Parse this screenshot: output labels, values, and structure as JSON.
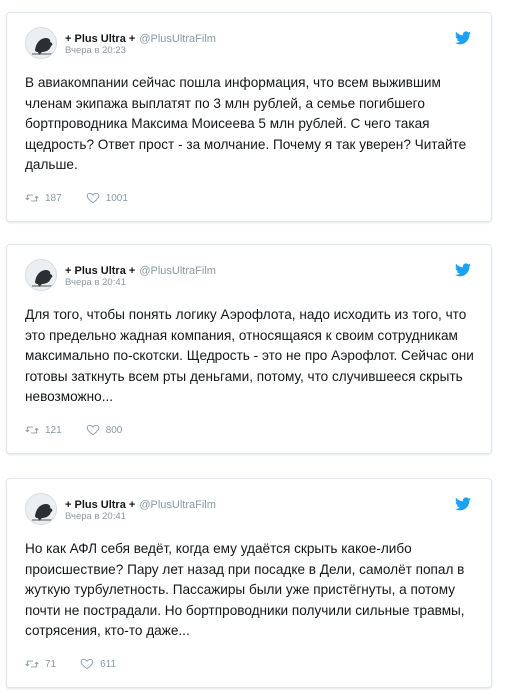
{
  "brand": {
    "twitter_blue": "#1da1f2",
    "muted": "#8899a6"
  },
  "tweets": [
    {
      "display_name": "+ Plus Ultra +",
      "handle": "@PlusUltraFilm",
      "time": "Вчера в 20:23",
      "text": "В авиакомпании сейчас пошла информация, что всем выжившим членам экипажа выплатят по 3 млн рублей, а семье погибшего бортпроводника Максима Моисеева 5 млн рублей. С чего такая щедрость? Ответ прост - за молчание. Почему я так уверен? Читайте дальше.",
      "retweets": "187",
      "likes": "1001",
      "icons": [
        "avatar",
        "twitter-bird-icon",
        "retweet-icon",
        "heart-icon"
      ]
    },
    {
      "display_name": "+ Plus Ultra +",
      "handle": "@PlusUltraFilm",
      "time": "Вчера в 20:41",
      "text": "Для того, чтобы понять логику Аэрофлота, надо исходить из того, что это предельно жадная компания, относящаяся к своим сотрудникам максимально по-скотски. Щедрость - это не про Аэрофлот. Сейчас они готовы заткнуть всем рты деньгами, потому, что случившееся скрыть невозможно...",
      "retweets": "121",
      "likes": "800",
      "icons": [
        "avatar",
        "twitter-bird-icon",
        "retweet-icon",
        "heart-icon"
      ]
    },
    {
      "display_name": "+ Plus Ultra +",
      "handle": "@PlusUltraFilm",
      "time": "Вчера в 20:41",
      "text": "Но как АФЛ себя ведёт, когда ему удаётся скрыть какое-либо происшествие? Пару лет назад при посадке в Дели, самолёт попал в жуткую турбулетность. Пассажиры были уже пристёгнуты, а потому почти не пострадали. Но бортпроводники получили сильные травмы, сотрясения, кто-то даже...",
      "retweets": "71",
      "likes": "611",
      "icons": [
        "avatar",
        "twitter-bird-icon",
        "retweet-icon",
        "heart-icon"
      ]
    }
  ]
}
